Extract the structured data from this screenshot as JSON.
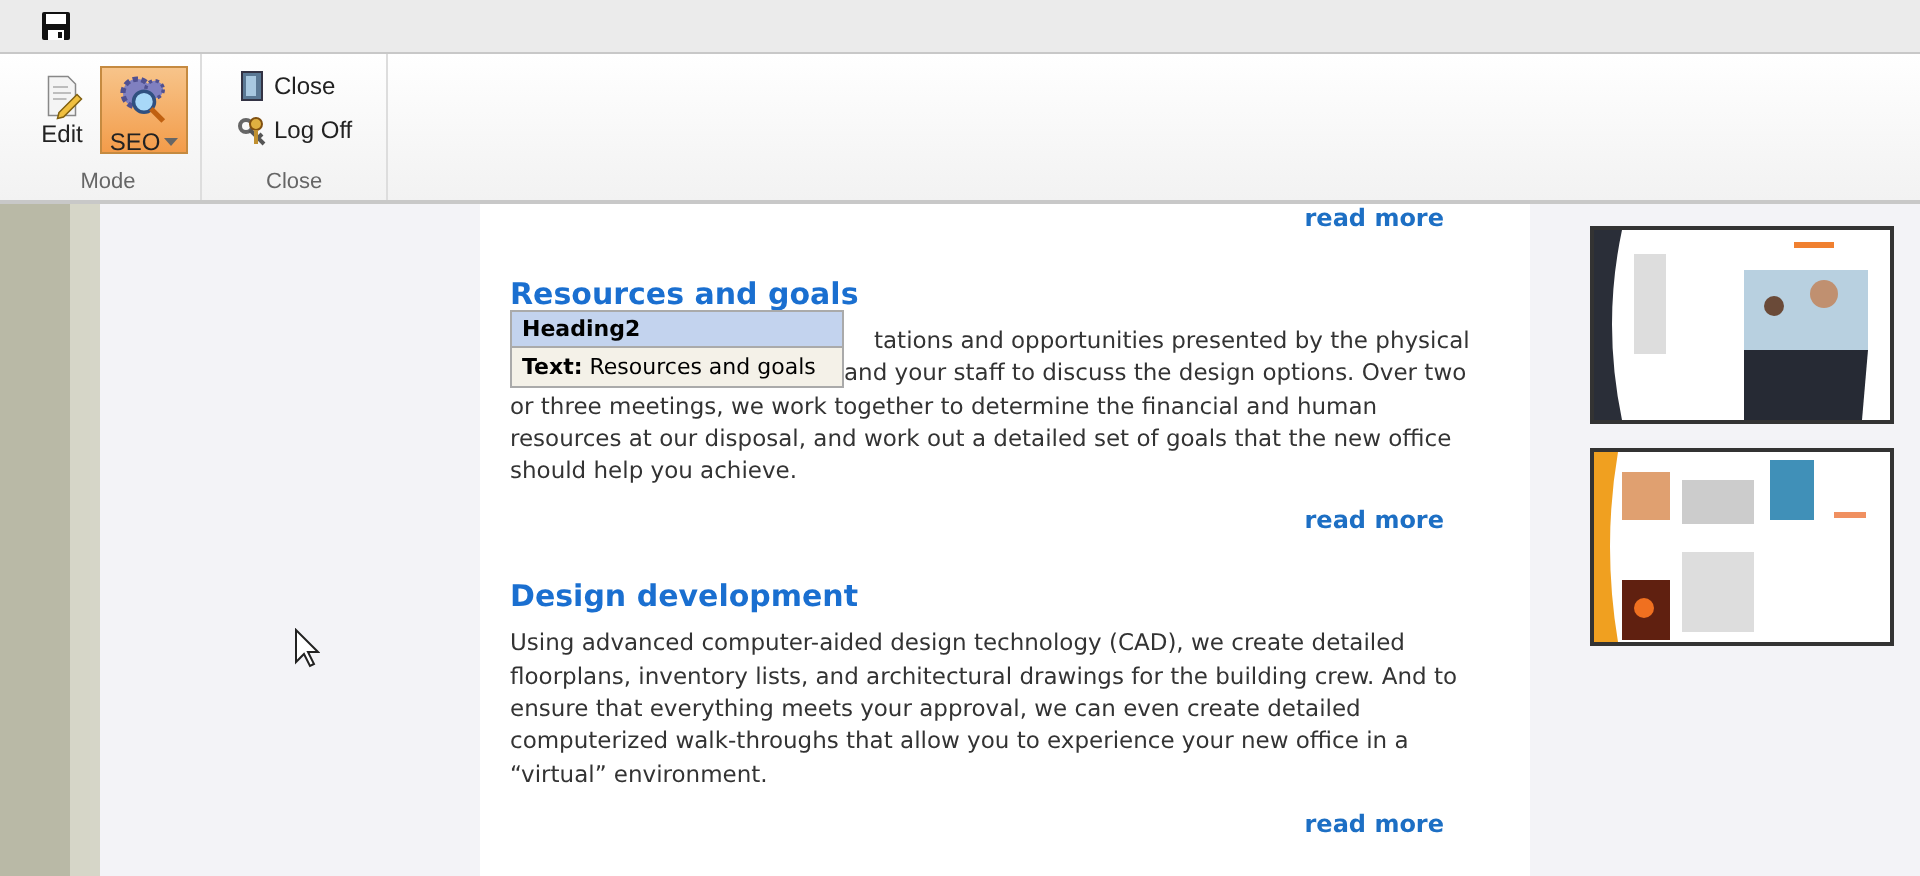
{
  "ribbon": {
    "groups": [
      {
        "label": "Mode",
        "items": [
          {
            "kind": "edit",
            "label": "Edit",
            "selected": false
          },
          {
            "kind": "seo",
            "label": "SEO",
            "selected": true
          }
        ]
      },
      {
        "label": "Close",
        "items": [
          {
            "kind": "close",
            "label": "Close",
            "selected": false
          },
          {
            "kind": "logoff",
            "label": "Log Off",
            "selected": false
          }
        ]
      }
    ]
  },
  "content": {
    "top_link": "read more",
    "sections": [
      {
        "title": "Resources and goals",
        "partly_hidden_lines": [
          "tations and opportunities presented by the physical",
          "and your staff to discuss the design options. Over two"
        ],
        "lines": [
          "or three meetings, we work together to determine the financial and human",
          "resources at our disposal, and work out a detailed set of goals that the new office",
          "should help you achieve."
        ],
        "link": "read more"
      },
      {
        "title": "Design development",
        "lines": [
          "Using advanced computer-aided design technology (CAD), we create detailed",
          "floorplans, inventory lists, and architectural drawings for the building crew. And to",
          "ensure that everything meets your approval, we can even create detailed",
          "computerized walk-throughs that allow you to experience your new office in a",
          "“virtual” environment."
        ],
        "link": "read more"
      }
    ],
    "tooltip": {
      "title": "Heading2",
      "label": "Text:",
      "value": "Resources and goals"
    }
  }
}
